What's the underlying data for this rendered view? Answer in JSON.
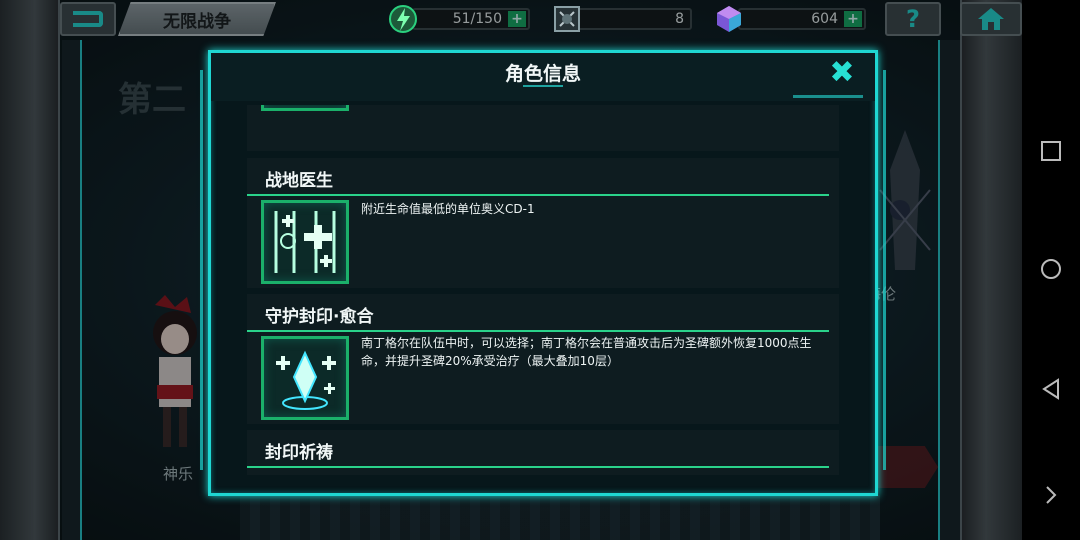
{
  "top_bar": {
    "mode_tab_label": "无限战争",
    "stamina": "51/150",
    "tickets": "8",
    "crystals": "604",
    "help_label": "?"
  },
  "background": {
    "stage_title": "第二",
    "right_character_name": "海伦",
    "left_character_name": "神乐"
  },
  "dialog": {
    "title": "角色信息",
    "close_label": "✖",
    "skills": [
      {
        "name": "",
        "description": ""
      },
      {
        "name": "战地医生",
        "description": "附近生命值最低的单位奥义CD-1"
      },
      {
        "name": "守护封印·愈合",
        "description": "南丁格尔在队伍中时，可以选择；南丁格尔会在普通攻击后为圣碑额外恢复1000点生命，并提升圣碑20%承受治疗（最大叠加10层）"
      },
      {
        "name": "封印祈祷",
        "description": ""
      }
    ]
  },
  "colors": {
    "accent": "#1fd7d2",
    "skill_line": "#2ad28a",
    "icon_border": "#1bb06a"
  },
  "icons": [
    "back-icon",
    "lightning-icon",
    "ticket-icon",
    "crystal-icon",
    "help-icon",
    "home-icon",
    "close-icon",
    "square-nav-icon",
    "circle-nav-icon",
    "back-nav-icon",
    "chevron-right-icon"
  ]
}
